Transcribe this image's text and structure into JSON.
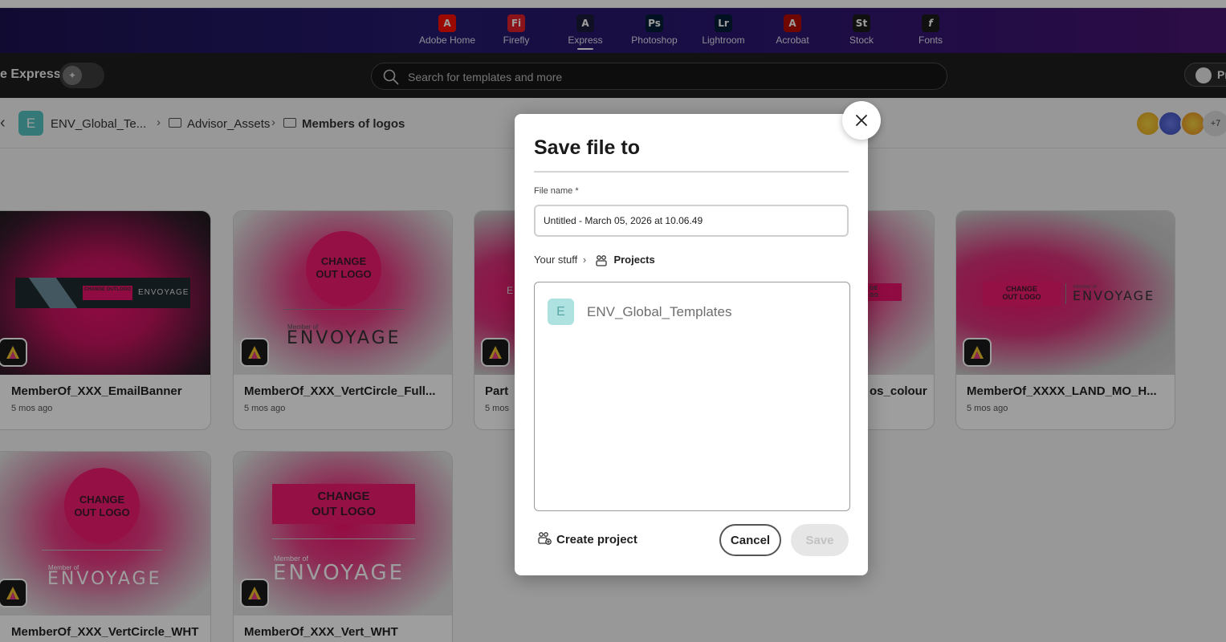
{
  "apps": [
    {
      "label": "Adobe Home",
      "glyph": "A",
      "color": "#fa0f00",
      "icon": "adobe-home-icon"
    },
    {
      "label": "Firefly",
      "glyph": "Fi",
      "color": "#e01f2a",
      "icon": "firefly-icon"
    },
    {
      "label": "Express",
      "glyph": "A",
      "color": "#1b1b3a",
      "icon": "express-icon"
    },
    {
      "label": "Photoshop",
      "glyph": "Ps",
      "color": "#001e36",
      "icon": "photoshop-icon"
    },
    {
      "label": "Lightroom",
      "glyph": "Lr",
      "color": "#001e36",
      "icon": "lightroom-icon"
    },
    {
      "label": "Acrobat",
      "glyph": "A",
      "color": "#b30b00",
      "icon": "acrobat-icon"
    },
    {
      "label": "Stock",
      "glyph": "St",
      "color": "#1a1a1a",
      "icon": "stock-icon"
    },
    {
      "label": "Fonts",
      "glyph": "f",
      "color": "#1a1a1a",
      "icon": "fonts-icon"
    }
  ],
  "header": {
    "brand": "e Express",
    "search_placeholder": "Search for templates and more",
    "premium_label": "Pr"
  },
  "breadcrumb": {
    "root_initial": "E",
    "root": "ENV_Global_Te...",
    "folder1": "Advisor_Assets",
    "folder2": "Members of logos",
    "more_count": "+7"
  },
  "cards": [
    {
      "title": "MemberOf_XXX_EmailBanner",
      "sub": "5 mos ago"
    },
    {
      "title": "MemberOf_XXX_VertCircle_Full...",
      "sub": "5 mos ago"
    },
    {
      "title": "Part",
      "sub": "5 mos"
    },
    {
      "title": "os_colour",
      "sub": ""
    },
    {
      "title": "MemberOf_XXXX_LAND_MO_H...",
      "sub": "5 mos ago"
    },
    {
      "title": "MemberOf_XXX_VertCircle_WHT",
      "sub": ""
    },
    {
      "title": "MemberOf_XXX_Vert_WHT",
      "sub": ""
    }
  ],
  "thumb_text": {
    "change": "CHANGE",
    "out_logo": "OUT LOGO",
    "member_of": "Member of",
    "envoyage": "ENVOYAGE",
    "banner_logo": "CHANGE OUTLOGO",
    "partial_e": "E",
    "partial_ge": "GE",
    "partial_go": "GO"
  },
  "dialog": {
    "title": "Save file to",
    "file_name_label": "File name *",
    "file_name_value": "Untitled - March 05, 2026 at 10.06.49",
    "path_root": "Your stuff",
    "path_current": "Projects",
    "project_initial": "E",
    "project_name": "ENV_Global_Templates",
    "create_project": "Create project",
    "cancel": "Cancel",
    "save": "Save"
  }
}
